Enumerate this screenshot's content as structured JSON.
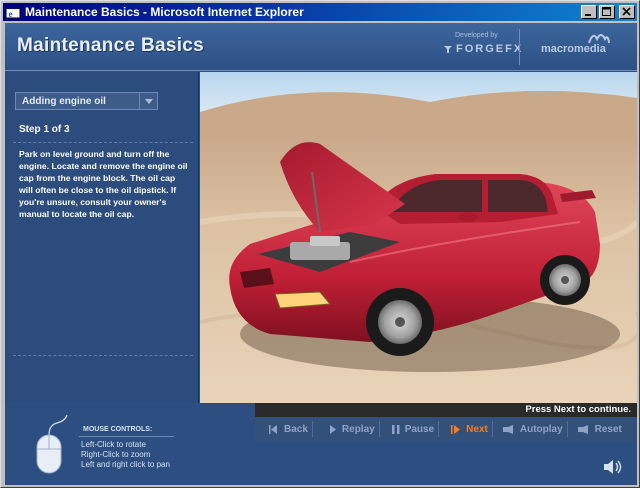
{
  "window": {
    "title": "Maintenance Basics - Microsoft Internet Explorer",
    "controls": {
      "minimize": "_",
      "maximize": "□",
      "close": "×"
    }
  },
  "header": {
    "title": "Maintenance Basics",
    "developed_by": "Developed by",
    "developer": "FORGEFX",
    "partner": "macromedia"
  },
  "panel": {
    "task_select": "Adding engine oil",
    "step": "Step 1 of 3",
    "instructions": "Park on level ground and turn off the engine.  Locate and remove the engine oil cap from the engine block. The oil cap will often be close to the oil dipstick.  If you're unsure, consult your owner's manual to locate the oil cap."
  },
  "hint": "Press Next to continue.",
  "controls": [
    {
      "label": "Back",
      "icon": "back-icon",
      "active": false
    },
    {
      "label": "Replay",
      "icon": "replay-icon",
      "active": false
    },
    {
      "label": "Pause",
      "icon": "pause-icon",
      "active": false
    },
    {
      "label": "Next",
      "icon": "next-icon",
      "active": true
    },
    {
      "label": "Autoplay",
      "icon": "autoplay-icon",
      "active": false
    },
    {
      "label": "Reset",
      "icon": "reset-icon",
      "active": false
    }
  ],
  "mouse": {
    "title": "MOUSE CONTROLS:",
    "lines": [
      "Left-Click to rotate",
      "Right-Click to zoom",
      "Left and right click to pan"
    ]
  },
  "colors": {
    "title_bar": "#000080",
    "panel_bg": "#2c4c7d",
    "active_control": "#ff7a1a",
    "car_body": "#c8243a"
  }
}
